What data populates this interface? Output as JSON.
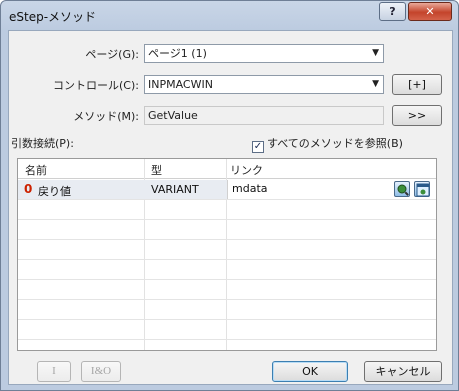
{
  "window": {
    "title": "eStep-メソッド",
    "help_label": "?",
    "close_label": "✕"
  },
  "form": {
    "page_label": "ページ(G):",
    "page_value": "ページ1 (1)",
    "control_label": "コントロール(C):",
    "control_value": "INPMACWIN",
    "add_button": "[+]",
    "method_label": "メソッド(M):",
    "method_value": "GetValue",
    "method_button": ">>",
    "args_label": "引数接続(P):",
    "show_all_label": "すべてのメソッドを参照(B)",
    "show_all_checked": "✓"
  },
  "table": {
    "headers": [
      "名前",
      "型",
      "リンク"
    ],
    "rows": [
      {
        "index": "0",
        "name": "戻り値",
        "type": "VARIANT",
        "link": "mdata"
      }
    ]
  },
  "footer": {
    "i_button": "I",
    "io_button": "I&O",
    "ok_button": "OK",
    "cancel_button": "キャンセル"
  },
  "icons": {
    "combo_arrow": "chevron-down-icon",
    "link_pick": "search-icon",
    "link_clear": "window-icon"
  }
}
